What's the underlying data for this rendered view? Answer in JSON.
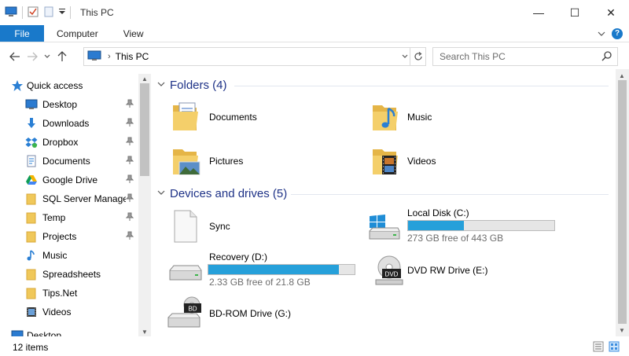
{
  "window": {
    "title": "This PC",
    "minimize_glyph": "—",
    "maximize_glyph": "☐",
    "close_glyph": "✕"
  },
  "ribbon": {
    "tabs": [
      {
        "label": "File",
        "active": true
      },
      {
        "label": "Computer"
      },
      {
        "label": "View"
      }
    ],
    "help_glyph": "?"
  },
  "navigation": {
    "address": "This PC",
    "search_placeholder": "Search This PC"
  },
  "sidebar": {
    "items": [
      {
        "label": "Quick access",
        "icon": "star-icon",
        "pinned": false
      },
      {
        "label": "Desktop",
        "icon": "desktop-icon",
        "pinned": true
      },
      {
        "label": "Downloads",
        "icon": "download-arrow-icon",
        "pinned": true
      },
      {
        "label": "Dropbox",
        "icon": "dropbox-icon",
        "pinned": true
      },
      {
        "label": "Documents",
        "icon": "documents-icon",
        "pinned": true
      },
      {
        "label": "Google Drive",
        "icon": "google-drive-icon",
        "pinned": true
      },
      {
        "label": "SQL Server Manager",
        "icon": "folder-icon",
        "pinned": true
      },
      {
        "label": "Temp",
        "icon": "folder-icon",
        "pinned": true
      },
      {
        "label": "Projects",
        "icon": "folder-icon",
        "pinned": true
      },
      {
        "label": "Music",
        "icon": "music-note-icon",
        "pinned": false
      },
      {
        "label": "Spreadsheets",
        "icon": "folder-icon",
        "pinned": false
      },
      {
        "label": "Tips.Net",
        "icon": "folder-icon",
        "pinned": false
      },
      {
        "label": "Videos",
        "icon": "videos-icon",
        "pinned": false
      },
      {
        "label": "Desktop",
        "icon": "desktop-icon",
        "pinned": false
      }
    ]
  },
  "folders": {
    "title": "Folders (4)",
    "items": [
      {
        "label": "Documents",
        "icon": "documents-folder-icon"
      },
      {
        "label": "Music",
        "icon": "music-folder-icon"
      },
      {
        "label": "Pictures",
        "icon": "pictures-folder-icon"
      },
      {
        "label": "Videos",
        "icon": "videos-folder-icon"
      }
    ]
  },
  "drives": {
    "title": "Devices and drives (5)",
    "items": [
      {
        "label": "Sync",
        "icon": "blank-document-icon"
      },
      {
        "label": "Local Disk (C:)",
        "icon": "windows-drive-icon",
        "free_text": "273 GB free of 443 GB",
        "used_fraction": 0.384
      },
      {
        "label": "Recovery (D:)",
        "icon": "hard-drive-icon",
        "free_text": "2.33 GB free of 21.8 GB",
        "used_fraction": 0.893
      },
      {
        "label": "DVD RW Drive (E:)",
        "icon": "dvd-drive-icon",
        "badge": "DVD"
      },
      {
        "label": "BD-ROM Drive (G:)",
        "icon": "bd-drive-icon",
        "badge": "BD"
      }
    ]
  },
  "status": {
    "item_count": "12 items"
  },
  "colors": {
    "accent": "#1979ca",
    "group_title": "#1e3287",
    "drive_fill": "#26a0da",
    "folder": "#f0c85a"
  }
}
